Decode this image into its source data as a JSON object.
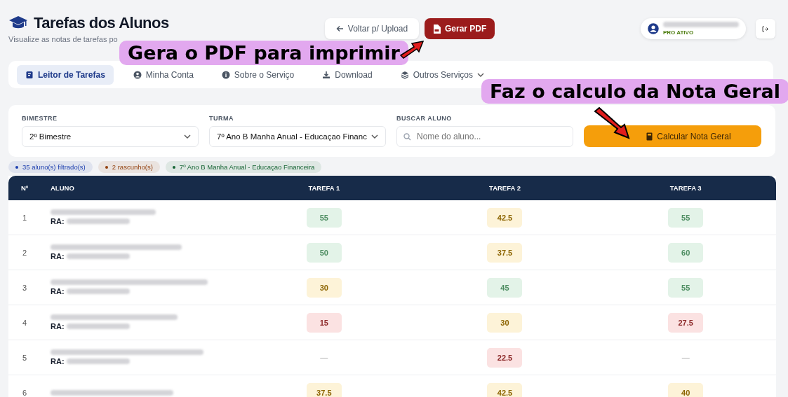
{
  "header": {
    "title": "Tarefas dos Alunos",
    "subtitle": "Visualize as notas de tarefas po",
    "back_button": "Voltar p/ Upload",
    "pdf_button": "Gerar PDF",
    "user": {
      "status": "PRO ATIVO"
    }
  },
  "nav": [
    {
      "label": "Leitor de Tarefas",
      "kind": "book",
      "selected": true
    },
    {
      "label": "Minha Conta",
      "kind": "user",
      "selected": false
    },
    {
      "label": "Sobre o Serviço",
      "kind": "info",
      "selected": false
    },
    {
      "label": "Download",
      "kind": "download",
      "selected": false
    },
    {
      "label": "Outros Serviços",
      "kind": "layers",
      "selected": false,
      "dropdown": true
    }
  ],
  "filters": {
    "bimestre": {
      "label": "BIMESTRE",
      "value": "2º Bimestre"
    },
    "turma": {
      "label": "TURMA",
      "value": "7º Ano B Manha Anual - Educaçao Financ"
    },
    "buscar": {
      "label": "BUSCAR ALUNO",
      "placeholder": "Nome do aluno..."
    },
    "calc_button": "Calcular Nota Geral"
  },
  "chips": [
    {
      "label": "35 aluno(s) filtrado(s)",
      "color": "#1e40af"
    },
    {
      "label": "2 rascunho(s)",
      "color": "#92400e"
    },
    {
      "label": "7º Ano B Manha Anual - Educaçao Financeira",
      "color": "#166534"
    }
  ],
  "table": {
    "columns": [
      "Nº",
      "ALUNO",
      "TAREFA 1",
      "TAREFA 2",
      "TAREFA 3"
    ],
    "rows": [
      {
        "n": "1",
        "ra_label": "RA:",
        "grades": [
          {
            "value": "55",
            "color": "#e3f3e8"
          },
          {
            "value": "42.5",
            "color": "#fdf3d8"
          },
          {
            "value": "55",
            "color": "#e3f3e8"
          }
        ]
      },
      {
        "n": "2",
        "ra_label": "RA:",
        "grades": [
          {
            "value": "50",
            "color": "#e3f3e8"
          },
          {
            "value": "37.5",
            "color": "#fdf3d8"
          },
          {
            "value": "60",
            "color": "#e3f3e8"
          }
        ]
      },
      {
        "n": "3",
        "ra_label": "RA:",
        "grades": [
          {
            "value": "30",
            "color": "#fdf3d8"
          },
          {
            "value": "45",
            "color": "#e3f3e8"
          },
          {
            "value": "55",
            "color": "#e3f3e8"
          }
        ]
      },
      {
        "n": "4",
        "ra_label": "RA:",
        "grades": [
          {
            "value": "15",
            "color": "#fbe2e2"
          },
          {
            "value": "30",
            "color": "#fdf3d8"
          },
          {
            "value": "27.5",
            "color": "#fbe2e2"
          }
        ]
      },
      {
        "n": "5",
        "ra_label": "RA:",
        "grades": [
          {
            "value": "—"
          },
          {
            "value": "22.5",
            "color": "#fbe2e2"
          },
          {
            "value": "—"
          }
        ]
      },
      {
        "n": "6",
        "grades": [
          {
            "value": "37.5",
            "color": "#fdf3d8"
          },
          {
            "value": "42.5",
            "color": "#fdf3d8"
          },
          {
            "value": "40",
            "color": "#fdf3d8"
          }
        ]
      }
    ]
  },
  "callouts": [
    {
      "text": "Gera o PDF para imprimir"
    },
    {
      "text": "Faz o calculo da Nota Geral"
    }
  ]
}
